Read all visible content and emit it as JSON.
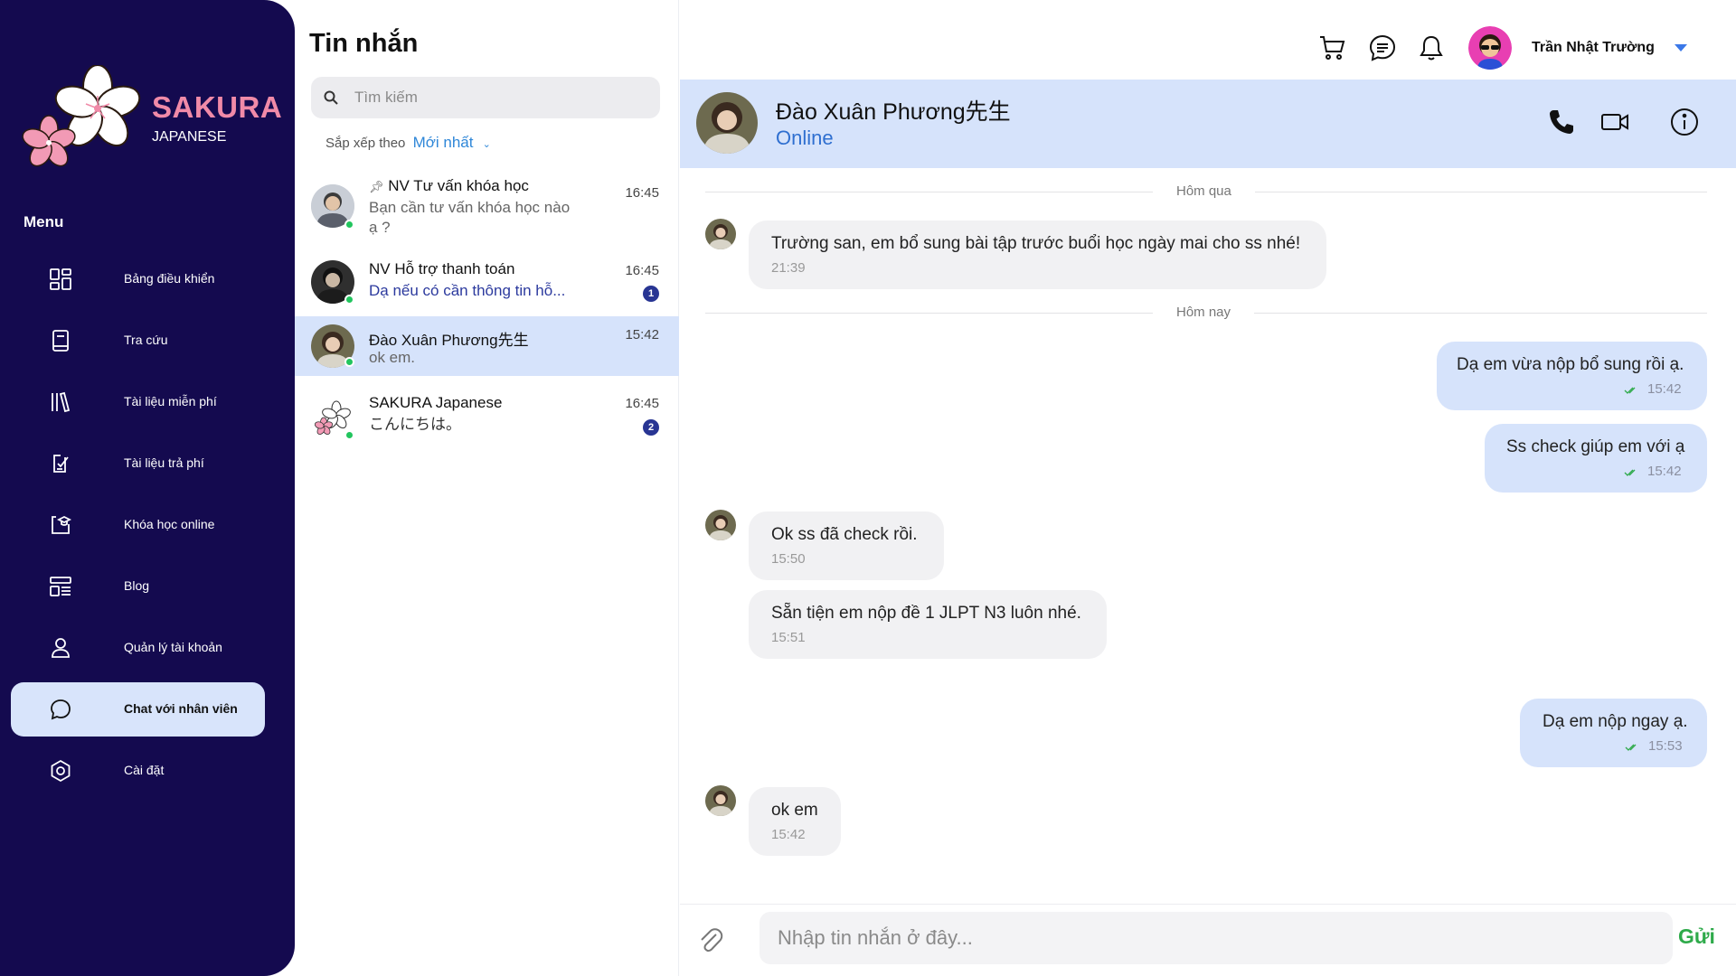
{
  "brand": {
    "name": "SAKURA",
    "sub": "JAPANESE"
  },
  "sidebar": {
    "menu_title": "Menu",
    "items": [
      {
        "label": "Bảng điều khiển",
        "icon": "dashboard-icon"
      },
      {
        "label": "Tra cứu",
        "icon": "book-icon"
      },
      {
        "label": "Tài liệu miễn phí",
        "icon": "library-icon"
      },
      {
        "label": "Tài liệu trả phí",
        "icon": "paid-document-icon"
      },
      {
        "label": "Khóa học online",
        "icon": "online-course-icon"
      },
      {
        "label": "Blog",
        "icon": "blog-icon"
      },
      {
        "label": "Quản lý tài khoản",
        "icon": "user-icon"
      },
      {
        "label": "Chat với nhân viên",
        "icon": "chat-icon",
        "active": true
      },
      {
        "label": "Cài đặt",
        "icon": "settings-icon"
      }
    ]
  },
  "list": {
    "title": "Tin nhắn",
    "search_placeholder": "Tìm kiếm",
    "sort_label": "Sắp xếp theo",
    "sort_value": "Mới nhất",
    "conversations": [
      {
        "name": "NV Tư vấn khóa học",
        "pinned": true,
        "message": "Bạn cần tư vấn khóa học nào ạ ?",
        "time": "16:45"
      },
      {
        "name": "NV Hỗ trợ thanh toán",
        "message": "Dạ nếu có cần thông tin hỗ...",
        "time": "16:45",
        "unread": "1"
      },
      {
        "name": "Đào Xuân Phương先生",
        "message": "ok em.",
        "time": "15:42",
        "selected": true
      },
      {
        "name": "SAKURA Japanese",
        "message": "こんにちは。",
        "time": "16:45",
        "unread": "2"
      }
    ]
  },
  "header": {
    "user_name": "Trần Nhật Trường",
    "icons": [
      "cart-icon",
      "notes-icon",
      "bell-icon"
    ]
  },
  "chat": {
    "name": "Đào Xuân Phương先生",
    "status": "Online",
    "dividers": [
      "Hôm qua",
      "Hôm nay"
    ],
    "messages": [
      {
        "dir": "in",
        "text": "Trường san, em bổ sung bài tập trước buổi học ngày mai cho ss nhé!",
        "time": "21:39"
      },
      {
        "dir": "out",
        "text": "Dạ em vừa nộp bổ sung rồi ạ.",
        "time": "15:42"
      },
      {
        "dir": "out",
        "text": "Ss check giúp em với ạ",
        "time": "15:42"
      },
      {
        "dir": "in",
        "text": "Ok ss đã check rồi.",
        "time": "15:50"
      },
      {
        "dir": "in",
        "text": "Sẵn tiện em nộp đề 1 JLPT N3 luôn nhé.",
        "time": "15:51"
      },
      {
        "dir": "out",
        "text": "Dạ em nộp ngay ạ.",
        "time": "15:53"
      },
      {
        "dir": "in",
        "text": "ok em",
        "time": "15:42"
      }
    ],
    "composer_placeholder": "Nhập tin nhắn ở đây...",
    "send_label": "Gửi"
  },
  "colors": {
    "sidebar": "#140a4f",
    "accent": "#d6e3fb",
    "brand": "#f08aa8",
    "online": "#22c55e",
    "send": "#2eaa4a"
  }
}
